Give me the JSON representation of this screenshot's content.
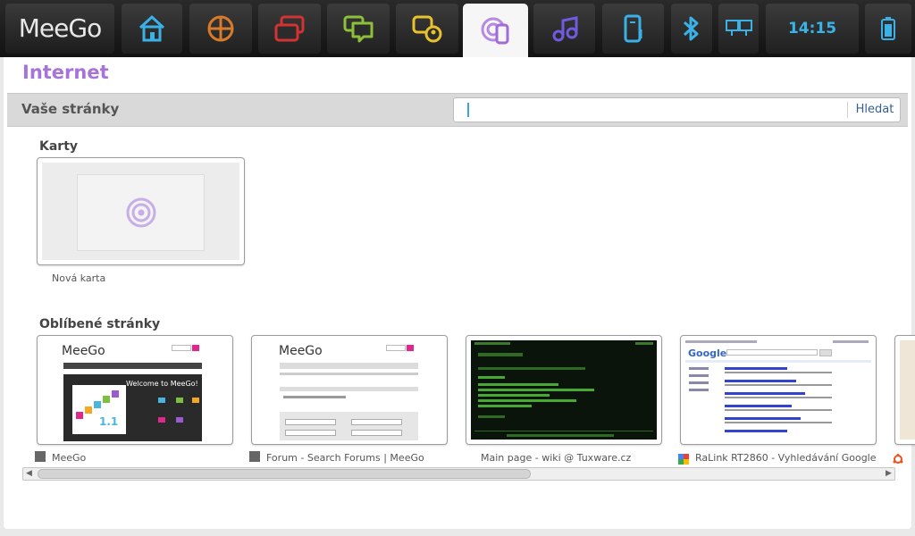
{
  "topbar": {
    "logo": "MeeGo",
    "clock": "14:15",
    "icons": [
      "home-icon",
      "zones-icon",
      "applications-icon",
      "messaging-icon",
      "people-icon",
      "internet-icon",
      "music-icon",
      "devices-icon",
      "bluetooth-icon",
      "network-icon",
      "battery-icon"
    ]
  },
  "app": {
    "title": "Internet"
  },
  "header": {
    "title": "Vaše stránky",
    "search_placeholder": "",
    "search_button": "Hledat"
  },
  "tabs_section": {
    "title": "Karty",
    "items": [
      {
        "label": "Nová karta"
      }
    ]
  },
  "favorites_section": {
    "title": "Oblíbené stránky",
    "items": [
      {
        "label": "MeeGo"
      },
      {
        "label": "Forum - Search Forums | MeeGo"
      },
      {
        "label": "Main page - wiki @ Tuxware.cz"
      },
      {
        "label": "RaLink RT2860 - Vyhledávání Google"
      }
    ]
  },
  "thumbnails": {
    "meego_logo": "MeeGo",
    "meego_hero": "Welcome to MeeGo!",
    "meego_version": "1.1",
    "forum_logo": "MeeGo",
    "google_logo": "Google"
  },
  "colors": {
    "accent": "#a673d8",
    "clock": "#38b4e8"
  }
}
